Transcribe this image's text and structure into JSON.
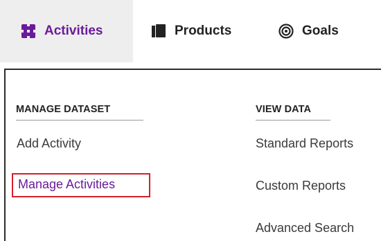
{
  "nav": {
    "tabs": [
      {
        "label": "Activities",
        "icon": "activities-puzzle-icon",
        "active": true
      },
      {
        "label": "Products",
        "icon": "books-icon",
        "active": false
      },
      {
        "label": "Goals",
        "icon": "target-icon",
        "active": false
      }
    ]
  },
  "menu": {
    "manage_dataset": {
      "heading": "MANAGE DATASET",
      "items": [
        "Add Activity",
        "Manage Activities"
      ]
    },
    "view_data": {
      "heading": "VIEW DATA",
      "items": [
        "Standard Reports",
        "Custom Reports",
        "Advanced Search"
      ]
    }
  },
  "colors": {
    "accent": "#6a1b9a",
    "highlight": "#d4202b",
    "active_tab_bg": "#eeeeee"
  }
}
